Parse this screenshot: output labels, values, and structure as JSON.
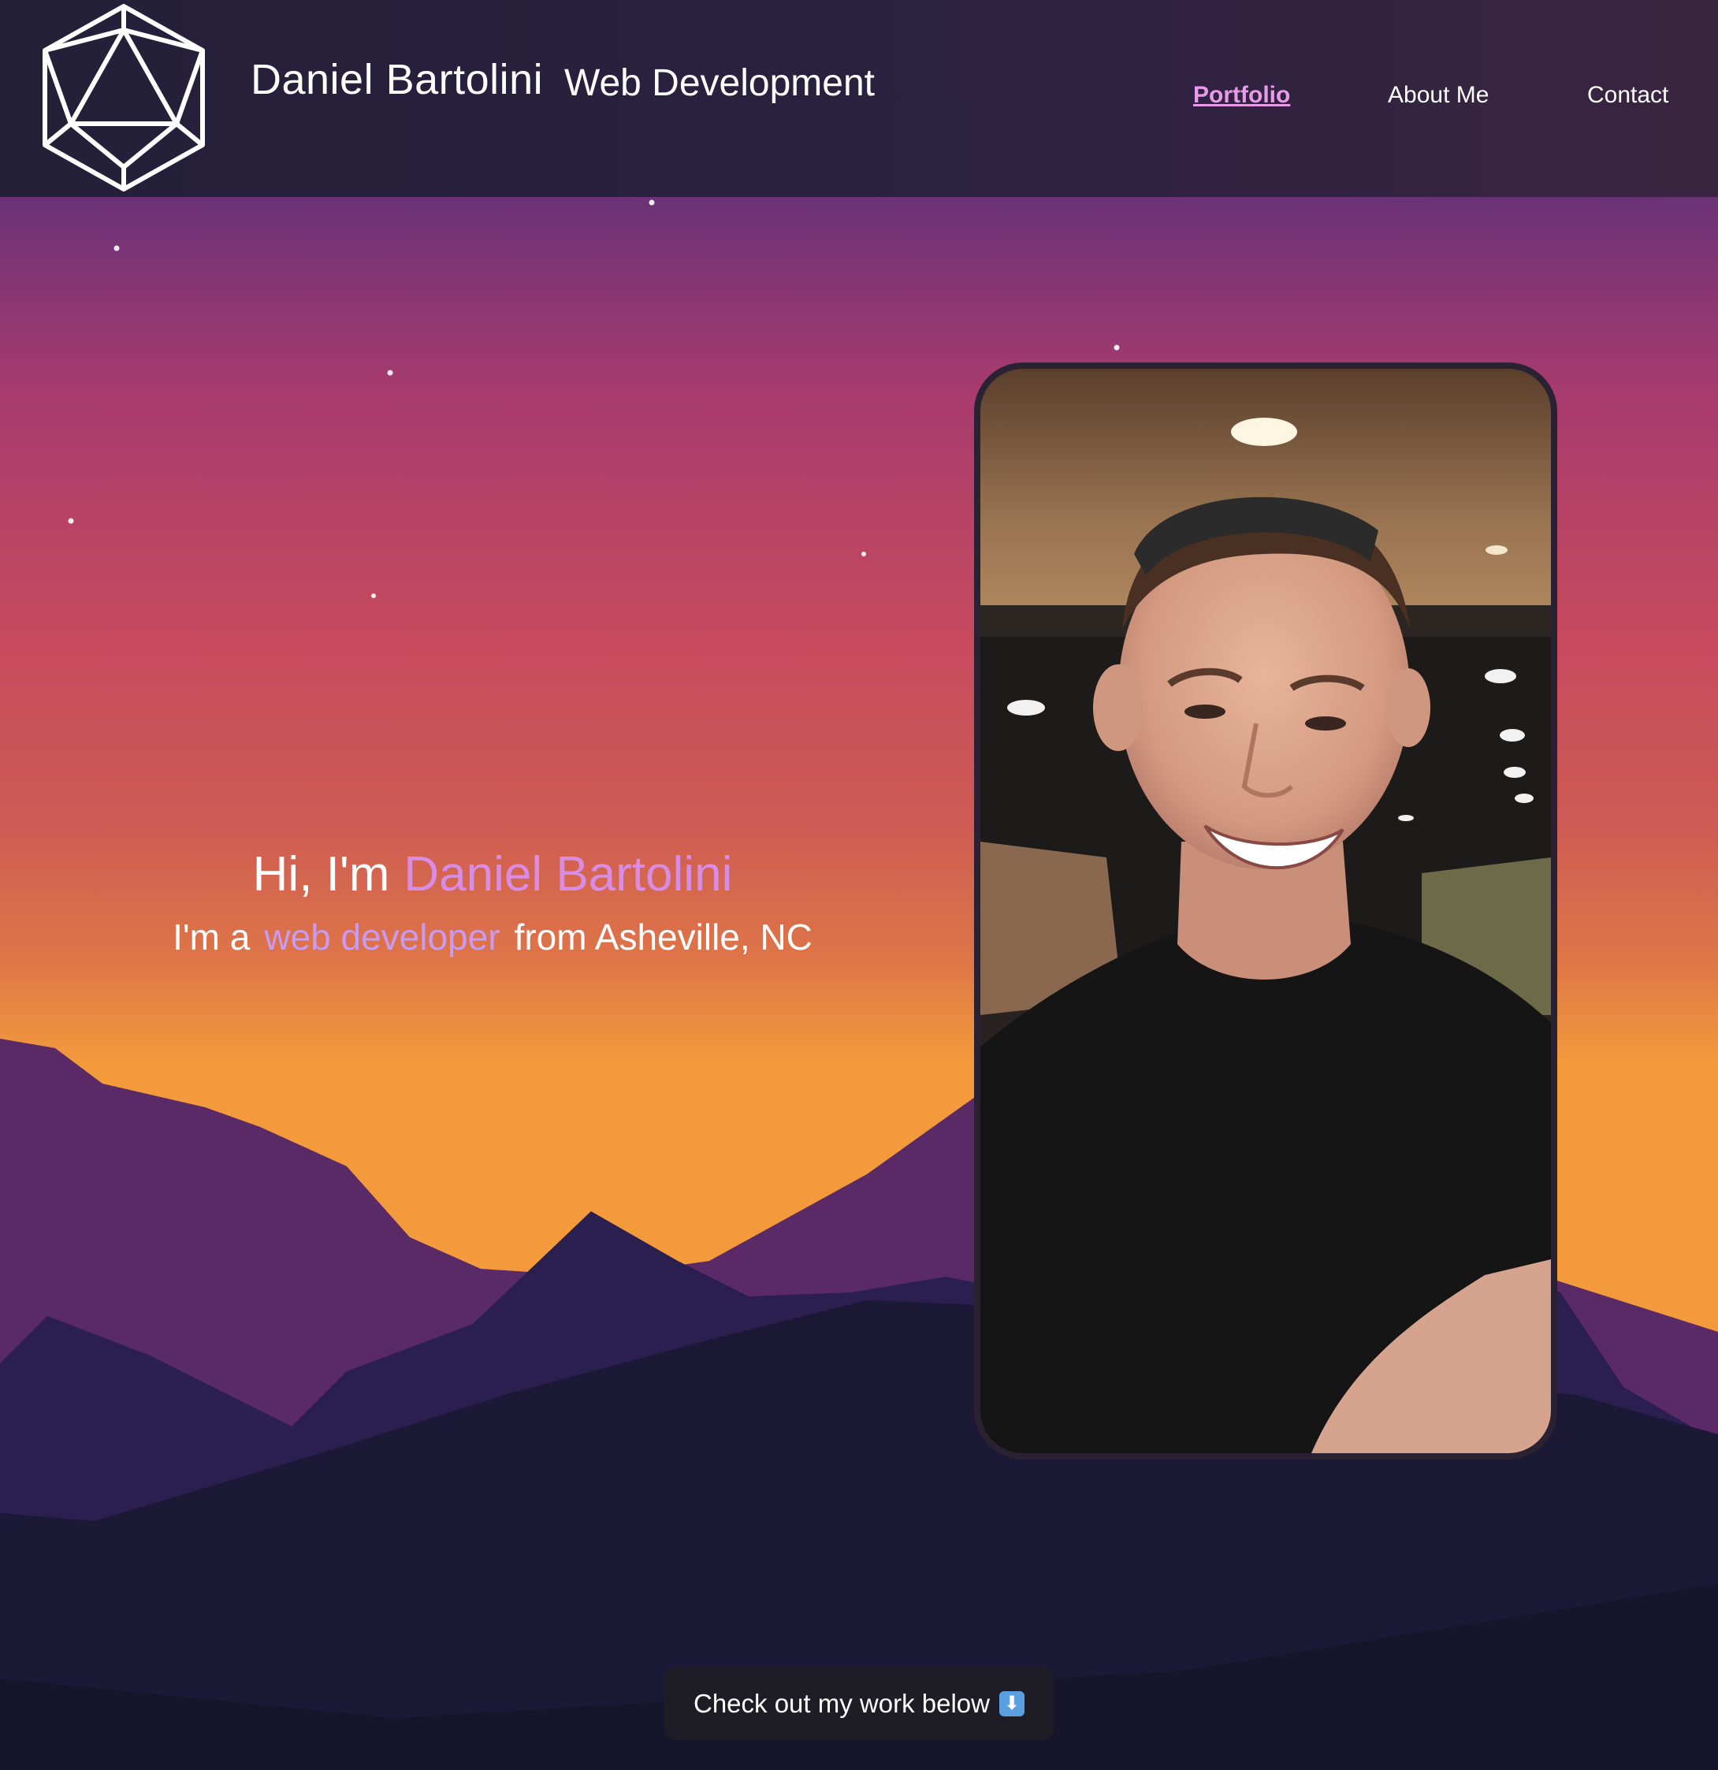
{
  "header": {
    "logo_icon": "icosahedron-logo-icon",
    "brand_name": "Daniel Bartolini",
    "brand_subtitle": "Web Development",
    "nav": [
      {
        "label": "Portfolio",
        "active": true
      },
      {
        "label": "About Me",
        "active": false
      },
      {
        "label": "Contact",
        "active": false
      }
    ]
  },
  "hero": {
    "greeting_prefix": "Hi, I'm",
    "greeting_name": "Daniel Bartolini",
    "tagline_prefix": "I'm a",
    "tagline_role": "web developer",
    "tagline_suffix": "from Asheville, NC",
    "photo_icon": "profile-photo"
  },
  "cta": {
    "label": "Check out my work below",
    "icon": "down-arrow-icon",
    "icon_glyph": "⬇"
  },
  "colors": {
    "accent_pink": "#d88ce3",
    "accent_purple": "#c89af0",
    "header_bg": "#2b2140",
    "night": "#17162e"
  }
}
